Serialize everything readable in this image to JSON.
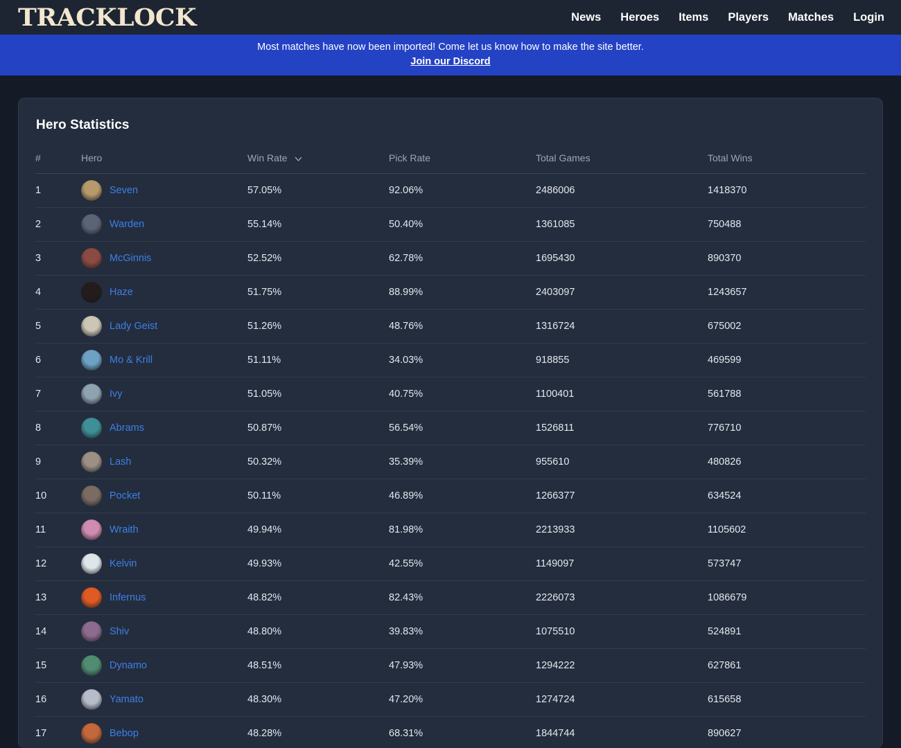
{
  "header": {
    "logo_text": "TRACKLOCK",
    "nav": [
      {
        "label": "News",
        "name": "nav-link-news"
      },
      {
        "label": "Heroes",
        "name": "nav-link-heroes"
      },
      {
        "label": "Items",
        "name": "nav-link-items"
      },
      {
        "label": "Players",
        "name": "nav-link-players"
      },
      {
        "label": "Matches",
        "name": "nav-link-matches"
      },
      {
        "label": "Login",
        "name": "nav-link-login"
      }
    ]
  },
  "announcement": {
    "text": "Most matches have now been imported! Come let us know how to make the site better.",
    "link_label": "Join our Discord",
    "background": "#2442c4"
  },
  "card": {
    "title": "Hero Statistics"
  },
  "table": {
    "sort_icon": "chevron-down-icon",
    "sorted_column": "Win Rate",
    "columns": [
      {
        "label": "#",
        "name": "column-header-rank"
      },
      {
        "label": "Hero",
        "name": "column-header-hero"
      },
      {
        "label": "Win Rate",
        "name": "column-header-win-rate"
      },
      {
        "label": "Pick Rate",
        "name": "column-header-pick-rate"
      },
      {
        "label": "Total Games",
        "name": "column-header-total-games"
      },
      {
        "label": "Total Wins",
        "name": "column-header-total-wins"
      }
    ],
    "rows": [
      {
        "rank": "1",
        "hero": "Seven",
        "win_rate": "57.05%",
        "pick_rate": "92.06%",
        "total_games": "2486006",
        "total_wins": "1418370",
        "avatar": "#b79a6b"
      },
      {
        "rank": "2",
        "hero": "Warden",
        "win_rate": "55.14%",
        "pick_rate": "50.40%",
        "total_games": "1361085",
        "total_wins": "750488",
        "avatar": "#5b6476"
      },
      {
        "rank": "3",
        "hero": "McGinnis",
        "win_rate": "52.52%",
        "pick_rate": "62.78%",
        "total_games": "1695430",
        "total_wins": "890370",
        "avatar": "#8b4a42"
      },
      {
        "rank": "4",
        "hero": "Haze",
        "win_rate": "51.75%",
        "pick_rate": "88.99%",
        "total_games": "2403097",
        "total_wins": "1243657",
        "avatar": "#241c1a"
      },
      {
        "rank": "5",
        "hero": "Lady Geist",
        "win_rate": "51.26%",
        "pick_rate": "48.76%",
        "total_games": "1316724",
        "total_wins": "675002",
        "avatar": "#ccc6b6"
      },
      {
        "rank": "6",
        "hero": "Mo & Krill",
        "win_rate": "51.11%",
        "pick_rate": "34.03%",
        "total_games": "918855",
        "total_wins": "469599",
        "avatar": "#6ea2c4"
      },
      {
        "rank": "7",
        "hero": "Ivy",
        "win_rate": "51.05%",
        "pick_rate": "40.75%",
        "total_games": "1100401",
        "total_wins": "561788",
        "avatar": "#8fa2b2"
      },
      {
        "rank": "8",
        "hero": "Abrams",
        "win_rate": "50.87%",
        "pick_rate": "56.54%",
        "total_games": "1526811",
        "total_wins": "776710",
        "avatar": "#3f8f96"
      },
      {
        "rank": "9",
        "hero": "Lash",
        "win_rate": "50.32%",
        "pick_rate": "35.39%",
        "total_games": "955610",
        "total_wins": "480826",
        "avatar": "#9c8f84"
      },
      {
        "rank": "10",
        "hero": "Pocket",
        "win_rate": "50.11%",
        "pick_rate": "46.89%",
        "total_games": "1266377",
        "total_wins": "634524",
        "avatar": "#7b6b63"
      },
      {
        "rank": "11",
        "hero": "Wraith",
        "win_rate": "49.94%",
        "pick_rate": "81.98%",
        "total_games": "2213933",
        "total_wins": "1105602",
        "avatar": "#d08bb0"
      },
      {
        "rank": "12",
        "hero": "Kelvin",
        "win_rate": "49.93%",
        "pick_rate": "42.55%",
        "total_games": "1149097",
        "total_wins": "573747",
        "avatar": "#dfe6ea"
      },
      {
        "rank": "13",
        "hero": "Infernus",
        "win_rate": "48.82%",
        "pick_rate": "82.43%",
        "total_games": "2226073",
        "total_wins": "1086679",
        "avatar": "#e05a24"
      },
      {
        "rank": "14",
        "hero": "Shiv",
        "win_rate": "48.80%",
        "pick_rate": "39.83%",
        "total_games": "1075510",
        "total_wins": "524891",
        "avatar": "#8c6b8e"
      },
      {
        "rank": "15",
        "hero": "Dynamo",
        "win_rate": "48.51%",
        "pick_rate": "47.93%",
        "total_games": "1294222",
        "total_wins": "627861",
        "avatar": "#4f8c72"
      },
      {
        "rank": "16",
        "hero": "Yamato",
        "win_rate": "48.30%",
        "pick_rate": "47.20%",
        "total_games": "1274724",
        "total_wins": "615658",
        "avatar": "#b8bcc8"
      },
      {
        "rank": "17",
        "hero": "Bebop",
        "win_rate": "48.28%",
        "pick_rate": "68.31%",
        "total_games": "1844744",
        "total_wins": "890627",
        "avatar": "#c4673a"
      }
    ]
  }
}
